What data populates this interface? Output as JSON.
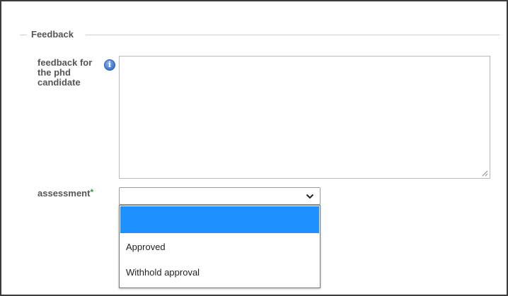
{
  "fieldset": {
    "legend": "Feedback"
  },
  "feedback_field": {
    "label": "feedback for the phd candidate",
    "info_icon_glyph": "i",
    "value": ""
  },
  "assessment_field": {
    "label": "assessment",
    "required_marker": "*",
    "selected_value": "",
    "options": [
      {
        "label": "",
        "highlighted": true
      },
      {
        "label": "Approved",
        "highlighted": false
      },
      {
        "label": "Withhold approval",
        "highlighted": false
      }
    ]
  },
  "colors": {
    "highlight": "#1e90ff",
    "required_star": "#2e9a3a",
    "label_text": "#555555",
    "info_icon": "#4d84d6"
  },
  "icons": {
    "info": "info-icon",
    "dropdown": "chevron-down-icon",
    "resize": "resize-grip-icon"
  }
}
